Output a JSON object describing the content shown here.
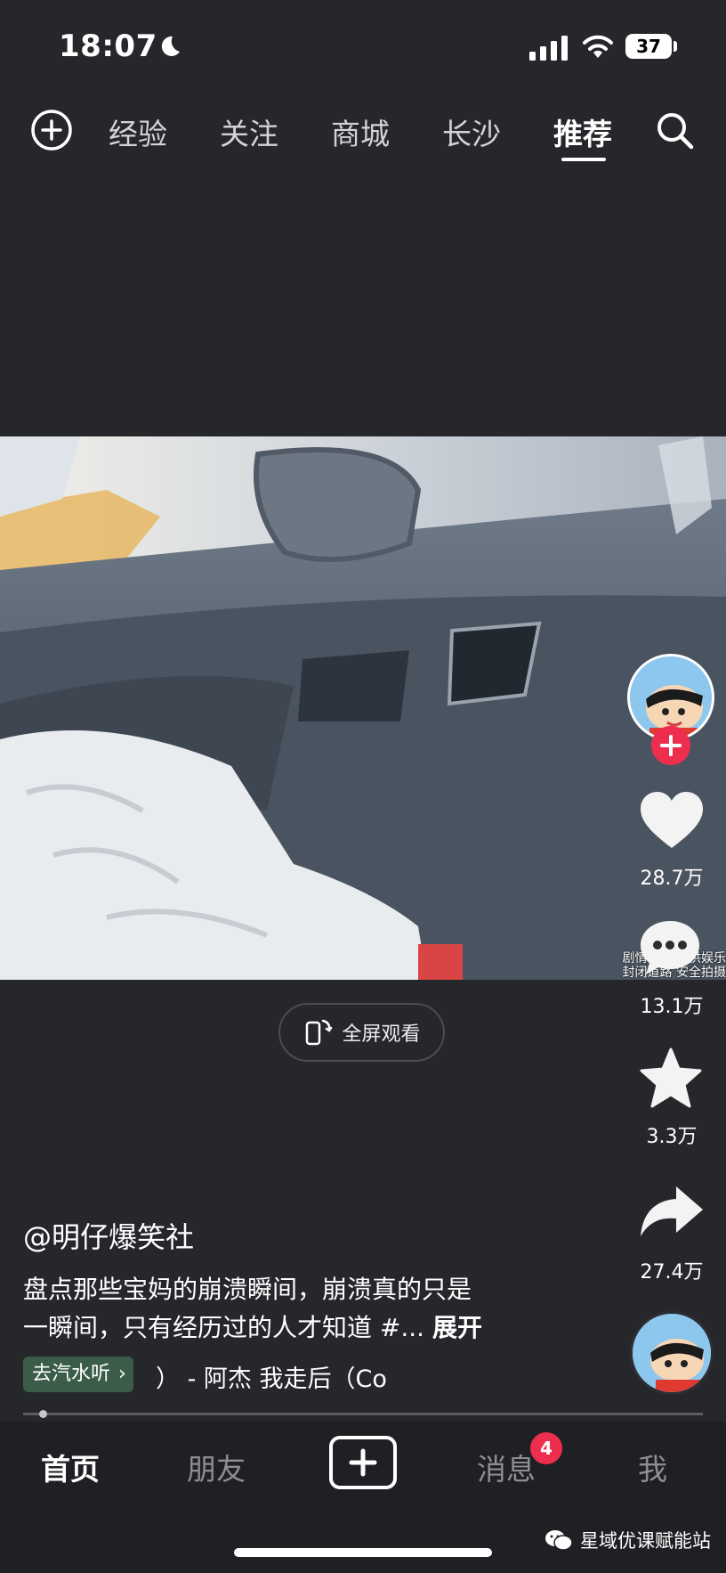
{
  "status_bar": {
    "time": "18:07",
    "battery": "37"
  },
  "top_nav": {
    "tabs": [
      {
        "label": "经验",
        "active": false
      },
      {
        "label": "关注",
        "active": false
      },
      {
        "label": "商城",
        "active": false
      },
      {
        "label": "长沙",
        "active": false
      },
      {
        "label": "推荐",
        "active": true
      }
    ]
  },
  "video": {
    "watermark_line1": "剧情演绎 仅供娱乐",
    "watermark_line2": "封闭道路 安全拍摄",
    "fullscreen_label": "全屏观看"
  },
  "actions": {
    "likes": "28.7万",
    "comments": "13.1万",
    "favorites": "3.3万",
    "shares": "27.4万"
  },
  "caption": {
    "author": "@明仔爆笑社",
    "description_line1": "盘点那些宝妈的崩溃瞬间，崩溃真的只是",
    "description_line2": "一瞬间，只有经历过的人才知道 #...",
    "expand": "展开",
    "music_tag": "去汽水听",
    "music_title": "）  - 阿杰    我走后（Co"
  },
  "bottom_tabs": {
    "home": "首页",
    "friends": "朋友",
    "messages": "消息",
    "messages_badge": "4",
    "me": "我"
  },
  "footer_watermark": "星域优课赋能站",
  "colors": {
    "background": "#25272b",
    "accent_red": "#ee2e4f",
    "music_tag_green": "#3a5c48"
  },
  "icons": [
    "moon-icon",
    "signal-icon",
    "wifi-icon",
    "plus-circle-icon",
    "search-icon",
    "fullscreen-phone-icon",
    "heart-icon",
    "comment-icon",
    "star-icon",
    "share-icon",
    "chevron-right-icon",
    "wechat-icon"
  ]
}
